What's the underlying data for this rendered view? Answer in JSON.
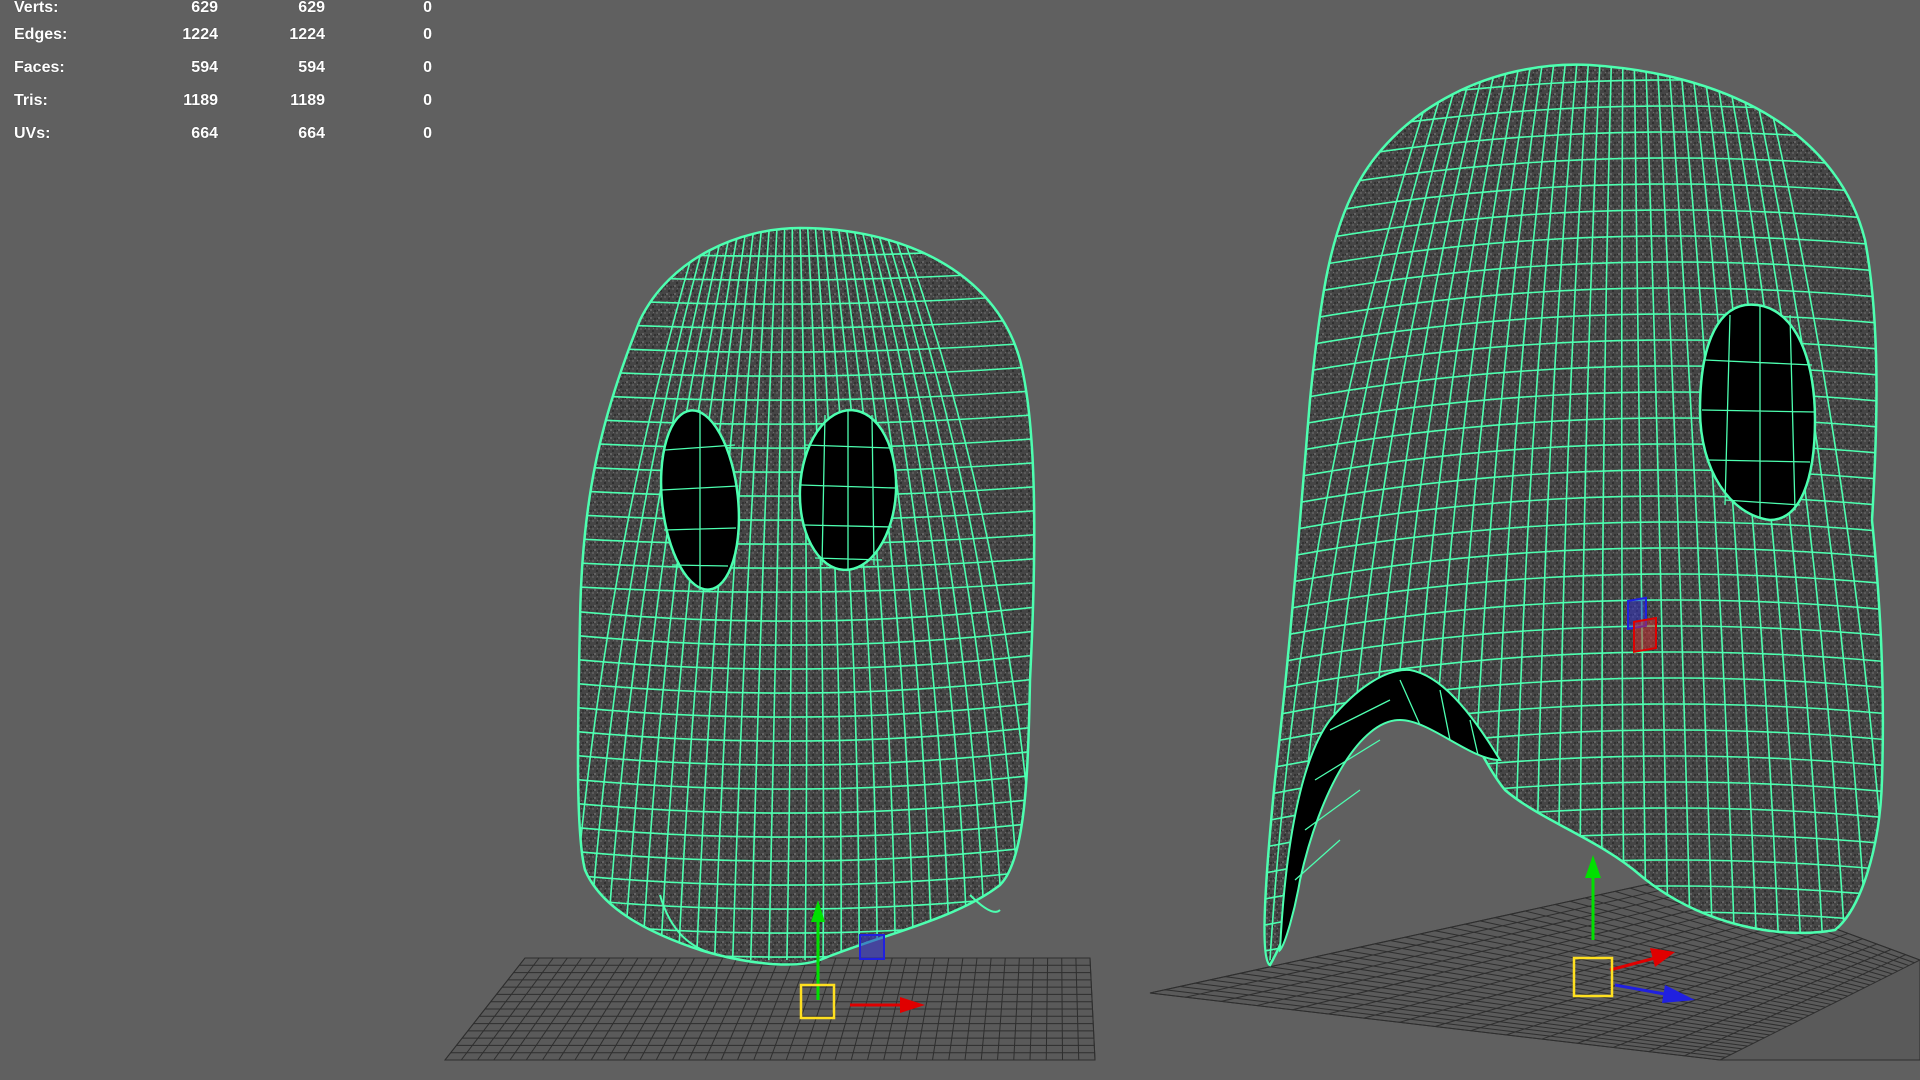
{
  "hud": {
    "rows": [
      {
        "label": "Verts:",
        "v1": "629",
        "v2": "629",
        "v3": "0"
      },
      {
        "label": "Edges:",
        "v1": "1224",
        "v2": "1224",
        "v3": "0"
      },
      {
        "label": "Faces:",
        "v1": "594",
        "v2": "594",
        "v3": "0"
      },
      {
        "label": "Tris:",
        "v1": "1189",
        "v2": "1189",
        "v3": "0"
      },
      {
        "label": "UVs:",
        "v1": "664",
        "v2": "664",
        "v3": "0"
      }
    ]
  },
  "colors": {
    "background": "#606060",
    "wireframe": "#4dffb0",
    "mesh_fill": "#3f3f3f",
    "hole": "#000000",
    "grid": "#2e2e2e",
    "axis_y": "#00e000",
    "axis_x": "#e00000",
    "axis_z": "#2020e0",
    "pivot": "#ffe020"
  },
  "icons": {
    "move_manipulator": "move-gizmo-icon",
    "pivot_handle": "pivot-square-icon"
  }
}
